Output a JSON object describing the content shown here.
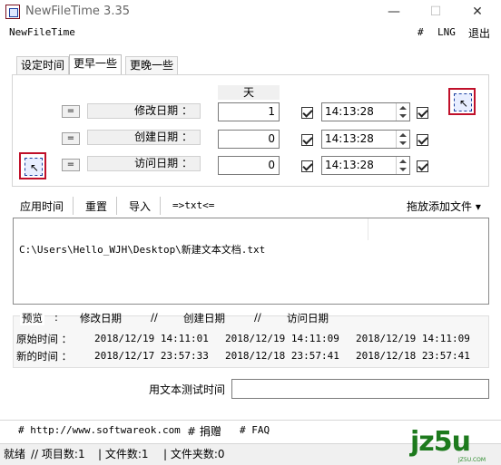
{
  "window": {
    "title": "NewFileTime 3.35",
    "minimize": "—",
    "maximize": "☐",
    "close": "✕"
  },
  "menu": {
    "app": "NewFileTime",
    "hash": "#",
    "lng": "LNG",
    "exit": "退出"
  },
  "tabs": [
    "设定时间",
    "更早一些",
    "更晚一些"
  ],
  "active_tab": 1,
  "unit_header": "天",
  "rows": [
    {
      "eq": "=",
      "label": "修改日期 ：",
      "days": "1",
      "time": "14:13:28"
    },
    {
      "eq": "=",
      "label": "创建日期 ：",
      "days": "0",
      "time": "14:13:28"
    },
    {
      "eq": "=",
      "label": "访问日期 ：",
      "days": "0",
      "time": "14:13:28"
    }
  ],
  "toolbar": {
    "apply": "应用时间",
    "reset": "重置",
    "import": "导入",
    "to_txt": "=>txt<=",
    "drag_add": "拖放添加文件 ▾"
  },
  "file_list": [
    "C:\\Users\\Hello_WJH\\Desktop\\新建文本文档.txt"
  ],
  "preview": {
    "headers": [
      "预览",
      ":",
      "修改日期",
      "//",
      "创建日期",
      "//",
      "访问日期"
    ],
    "original_label": "原始时间 ：",
    "new_label": "新的时间 ：",
    "original": [
      "2018/12/19 14:11:01",
      "2018/12/19 14:11:09",
      "2018/12/19 14:11:09"
    ],
    "new": [
      "2018/12/17 23:57:33",
      "2018/12/18 23:57:41",
      "2018/12/18 23:57:41"
    ]
  },
  "test": {
    "label": "用文本测试时间",
    "value": ""
  },
  "links": {
    "website": "# http://www.softwareok.com",
    "donate": "# 捐赠",
    "faq": "# FAQ"
  },
  "status": {
    "ready": "就绪",
    "items": "// 项目数:1",
    "files": "| 文件数:1",
    "folders": "| 文件夹数:0"
  },
  "watermark": {
    "logo": "jz5u",
    "sub": "JZ5U.COM"
  }
}
